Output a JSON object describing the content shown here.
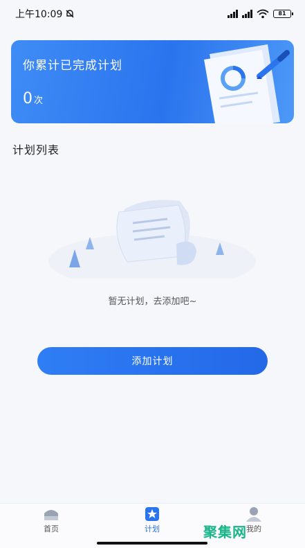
{
  "status_bar": {
    "time": "上午10:09",
    "battery": "81",
    "icons": [
      "mute-bell-icon",
      "signal-icon",
      "signal-icon",
      "wifi-icon",
      "battery-icon"
    ]
  },
  "banner": {
    "title": "你累计已完成计划",
    "count": "0",
    "unit": "次"
  },
  "plan_list": {
    "title": "计划列表",
    "empty_text": "暂无计划，去添加吧~"
  },
  "add_button": {
    "label": "添加计划"
  },
  "bottom_nav": {
    "items": [
      {
        "label": "首页",
        "icon": "home-icon"
      },
      {
        "label": "计划",
        "icon": "plan-star-icon",
        "active": true
      },
      {
        "label": "我的",
        "icon": "person-icon"
      }
    ]
  },
  "watermark": "聚集网",
  "colors": {
    "accent": "#2a74ee",
    "background": "#f6f7fb"
  }
}
